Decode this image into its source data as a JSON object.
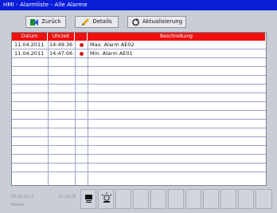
{
  "window": {
    "title": "HMI - Alarmliste - Alle Alarme"
  },
  "toolbar": {
    "back_label": "Zurück",
    "details_label": "Details",
    "refresh_label": "Aktualisierung"
  },
  "table": {
    "columns": [
      "Datum",
      "Uhrzeit",
      "",
      "Beschreibung"
    ],
    "rows": [
      {
        "date": "11.04.2011",
        "time": "14:49:36",
        "icon": "alarm-bell-icon",
        "description": "Max. Alarm AE02"
      },
      {
        "date": "11.04.2011",
        "time": "14:47:06",
        "icon": "alarm-bell-icon",
        "description": "Min. Alarm AE01"
      }
    ]
  },
  "statusbar": {
    "date_faded": "00.00.2012",
    "time_faded": "11:18:08",
    "user_faded": "Master"
  },
  "colors": {
    "title_bar": "#0a1ed8",
    "header_red": "#ef1010",
    "background": "#c9cdd6",
    "grid_line": "#9aa4c4"
  }
}
